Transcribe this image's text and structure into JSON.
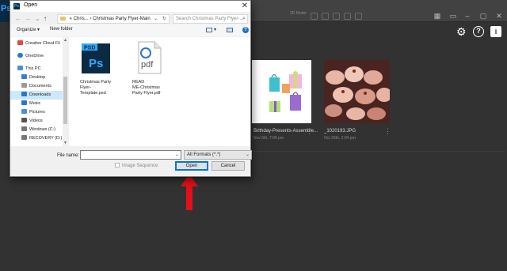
{
  "photoshop": {
    "logo": "Ps",
    "mode_label": "3D Mode:",
    "thumbnails": [
      {
        "name": "Birthday-Presents-Assemble...",
        "date": "Nov 5th, 7:06 pm"
      },
      {
        "name": "_1020193.JPG",
        "date": "Oct 26th, 2:04 pm"
      }
    ],
    "more_glyph": "⋮"
  },
  "dialog": {
    "title": "Open",
    "close_glyph": "✕",
    "nav": {
      "back": "←",
      "forward": "→",
      "dropdown": "⌄",
      "up": "↑"
    },
    "address": {
      "prefix": "«",
      "crumbs": [
        "Chris...",
        "Christmas Party Flyer-Main"
      ],
      "sep": "›"
    },
    "search_placeholder": "Search Christmas Party Flyer-...",
    "toolbar": {
      "organize": "Organize ▾",
      "new_folder": "New folder"
    },
    "nav_items": [
      {
        "label": "Creative Cloud Fil",
        "icon": "creative-cloud-icon",
        "color": "#e04a3f",
        "indent": false
      },
      {
        "label": "OneDrive",
        "icon": "onedrive-icon",
        "color": "#2b77d0",
        "indent": false
      },
      {
        "label": "This PC",
        "icon": "this-pc-icon",
        "color": "#4a90d9",
        "indent": false
      },
      {
        "label": "Desktop",
        "icon": "desktop-icon",
        "color": "#3a7bd5",
        "indent": true
      },
      {
        "label": "Documents",
        "icon": "documents-icon",
        "color": "#8a8a8a",
        "indent": true
      },
      {
        "label": "Downloads",
        "icon": "downloads-icon",
        "color": "#2b77d0",
        "indent": true,
        "selected": true
      },
      {
        "label": "Music",
        "icon": "music-icon",
        "color": "#2b77d0",
        "indent": true
      },
      {
        "label": "Pictures",
        "icon": "pictures-icon",
        "color": "#4a90d9",
        "indent": true
      },
      {
        "label": "Videos",
        "icon": "videos-icon",
        "color": "#555",
        "indent": true
      },
      {
        "label": "Windows (C:)",
        "icon": "drive-icon",
        "color": "#777",
        "indent": true
      },
      {
        "label": "RECOVERY (D:)",
        "icon": "drive-icon",
        "color": "#777",
        "indent": true
      }
    ],
    "files": [
      {
        "name": "Christmas Party Flyer-Template.psd",
        "lines": [
          "Christmas Party",
          "Flyer-",
          "Template.psd"
        ],
        "icon_label": "Ps",
        "badge": "PSD"
      },
      {
        "name": "READ ME-Christmas Party Flyer.pdf",
        "lines": [
          "READ",
          "ME-Christmas",
          "Party Flyer.pdf"
        ],
        "icon_label": "pdf"
      }
    ],
    "file_name_label": "File name:",
    "file_name_value": "",
    "format_value": "All Formats (*.*)",
    "image_sequence_label": "Image Sequence",
    "open_label": "Open",
    "cancel_label": "Cancel"
  }
}
